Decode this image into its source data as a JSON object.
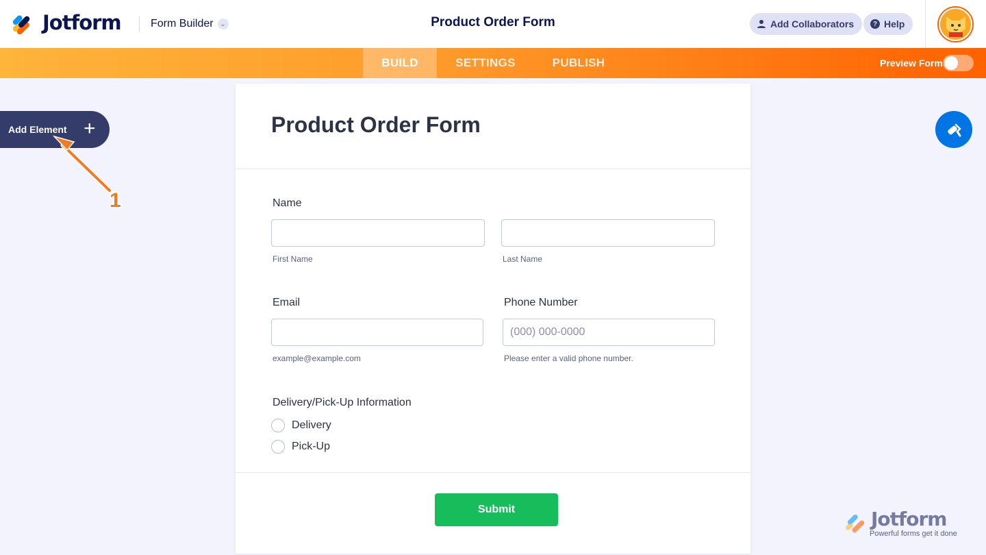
{
  "header": {
    "brand": "Jotform",
    "mode_label": "Form Builder",
    "form_title": "Product Order Form",
    "add_collaborators": "Add Collaborators",
    "help": "Help"
  },
  "nav": {
    "tabs": [
      "BUILD",
      "SETTINGS",
      "PUBLISH"
    ],
    "active_tab": "BUILD",
    "preview_label": "Preview Form",
    "preview_on": false
  },
  "sidebar": {
    "add_element": "Add Element"
  },
  "annotation": {
    "step": "1"
  },
  "form": {
    "title": "Product Order Form",
    "name": {
      "label": "Name",
      "first_value": "",
      "last_value": "",
      "first_sublabel": "First Name",
      "last_sublabel": "Last Name"
    },
    "email": {
      "label": "Email",
      "value": "",
      "sublabel": "example@example.com"
    },
    "phone": {
      "label": "Phone Number",
      "placeholder": "(000) 000-0000",
      "sublabel": "Please enter a valid phone number."
    },
    "delivery": {
      "label": "Delivery/Pick-Up Information",
      "options": [
        "Delivery",
        "Pick-Up"
      ]
    },
    "submit": "Submit"
  },
  "watermark": {
    "brand": "Jotform",
    "tagline": "Powerful forms get it done"
  },
  "colors": {
    "orange": "#ff6100",
    "navy": "#0a1551",
    "submit_green": "#18bd5b",
    "designer_blue": "#0075e3"
  }
}
